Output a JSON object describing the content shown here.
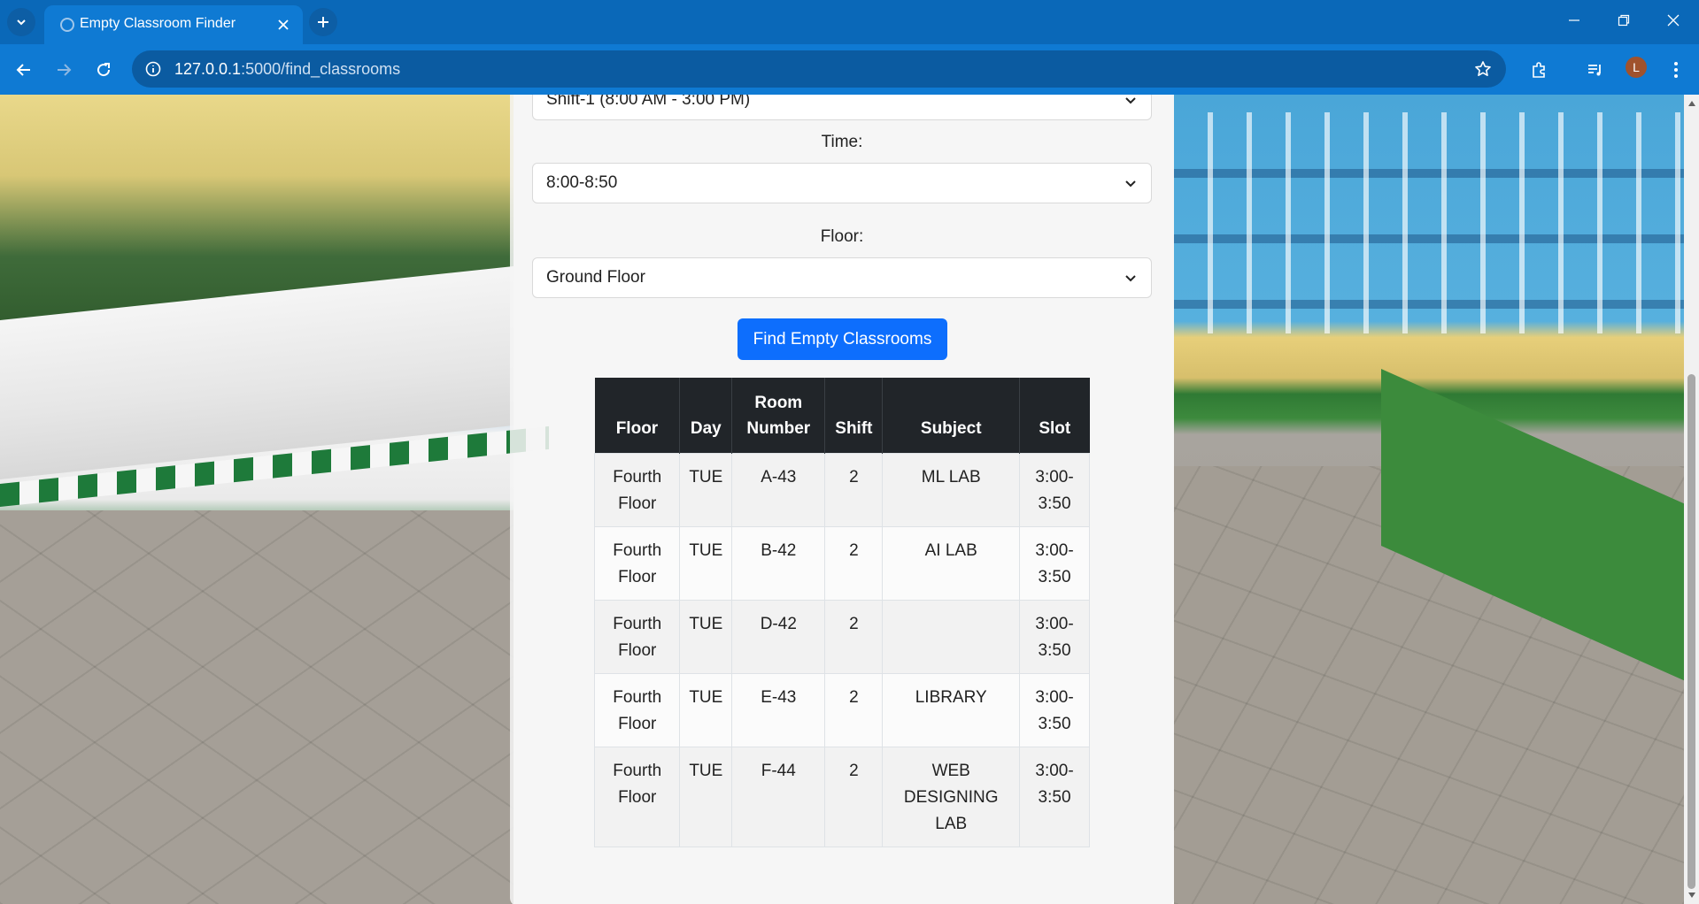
{
  "browser": {
    "tab_title": "Empty Classroom Finder",
    "url_host": "127.0.0.1",
    "url_path": ":5000/find_classrooms",
    "profile_initial": "L"
  },
  "form": {
    "shift_value": "Shift-1 (8:00 AM - 3:00 PM)",
    "time_label": "Time:",
    "time_value": "8:00-8:50",
    "floor_label": "Floor:",
    "floor_value": "Ground Floor",
    "submit_label": "Find Empty Classrooms"
  },
  "table": {
    "headers": [
      "Floor",
      "Day",
      "Room Number",
      "Shift",
      "Subject",
      "Slot"
    ],
    "rows": [
      {
        "floor": "Fourth Floor",
        "day": "TUE",
        "room": "A-43",
        "shift": "2",
        "subject": "ML LAB",
        "slot": "3:00-3:50"
      },
      {
        "floor": "Fourth Floor",
        "day": "TUE",
        "room": "B-42",
        "shift": "2",
        "subject": "AI LAB",
        "slot": "3:00-3:50"
      },
      {
        "floor": "Fourth Floor",
        "day": "TUE",
        "room": "D-42",
        "shift": "2",
        "subject": "",
        "slot": "3:00-3:50"
      },
      {
        "floor": "Fourth Floor",
        "day": "TUE",
        "room": "E-43",
        "shift": "2",
        "subject": "LIBRARY",
        "slot": "3:00-3:50"
      },
      {
        "floor": "Fourth Floor",
        "day": "TUE",
        "room": "F-44",
        "shift": "2",
        "subject": "WEB DESIGNING LAB",
        "slot": "3:00-3:50"
      }
    ]
  },
  "colors": {
    "browser_chrome": "#0f7ad3",
    "primary_button": "#0d6efd",
    "table_header": "#212529"
  },
  "icons": [
    "tab-search-icon",
    "globe-icon",
    "close-icon",
    "plus-icon",
    "minimize-icon",
    "restore-icon",
    "back-icon",
    "forward-icon",
    "reload-icon",
    "info-icon",
    "star-icon",
    "extensions-icon",
    "media-icon",
    "more-icon",
    "chevron-down-icon"
  ]
}
